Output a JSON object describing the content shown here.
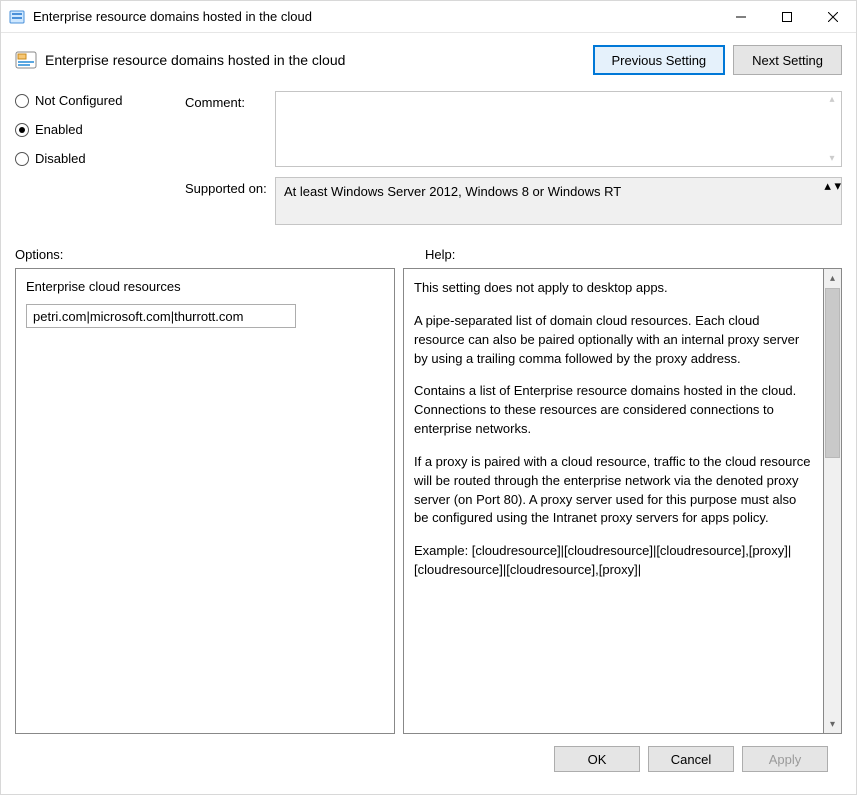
{
  "window": {
    "title": "Enterprise resource domains hosted in the cloud"
  },
  "header": {
    "subtitle": "Enterprise resource domains hosted in the cloud",
    "previous_setting": "Previous Setting",
    "next_setting": "Next Setting"
  },
  "state": {
    "not_configured": "Not Configured",
    "enabled": "Enabled",
    "disabled": "Disabled",
    "selected": "enabled"
  },
  "comment": {
    "label": "Comment:",
    "value": ""
  },
  "supported": {
    "label": "Supported on:",
    "value": "At least Windows Server 2012, Windows 8 or Windows RT"
  },
  "labels": {
    "options": "Options:",
    "help": "Help:"
  },
  "options": {
    "field_label": "Enterprise cloud resources",
    "field_value": "petri.com|microsoft.com|thurrott.com"
  },
  "help": {
    "p1": "This setting does not apply to desktop apps.",
    "p2": "A pipe-separated list of domain cloud resources. Each cloud resource can also be paired optionally with an internal proxy server by using a trailing comma followed by the proxy address.",
    "p3": "Contains a list of Enterprise resource domains hosted in the cloud. Connections to these resources are considered connections to enterprise networks.",
    "p4": "If a proxy is paired with a cloud resource, traffic to the cloud resource will be routed through the enterprise network via the denoted proxy server (on Port 80). A proxy server used for this purpose must also be configured using the Intranet proxy servers for apps policy.",
    "p5": "Example: [cloudresource]|[cloudresource]|[cloudresource],[proxy]|[cloudresource]|[cloudresource],[proxy]|"
  },
  "footer": {
    "ok": "OK",
    "cancel": "Cancel",
    "apply": "Apply"
  }
}
